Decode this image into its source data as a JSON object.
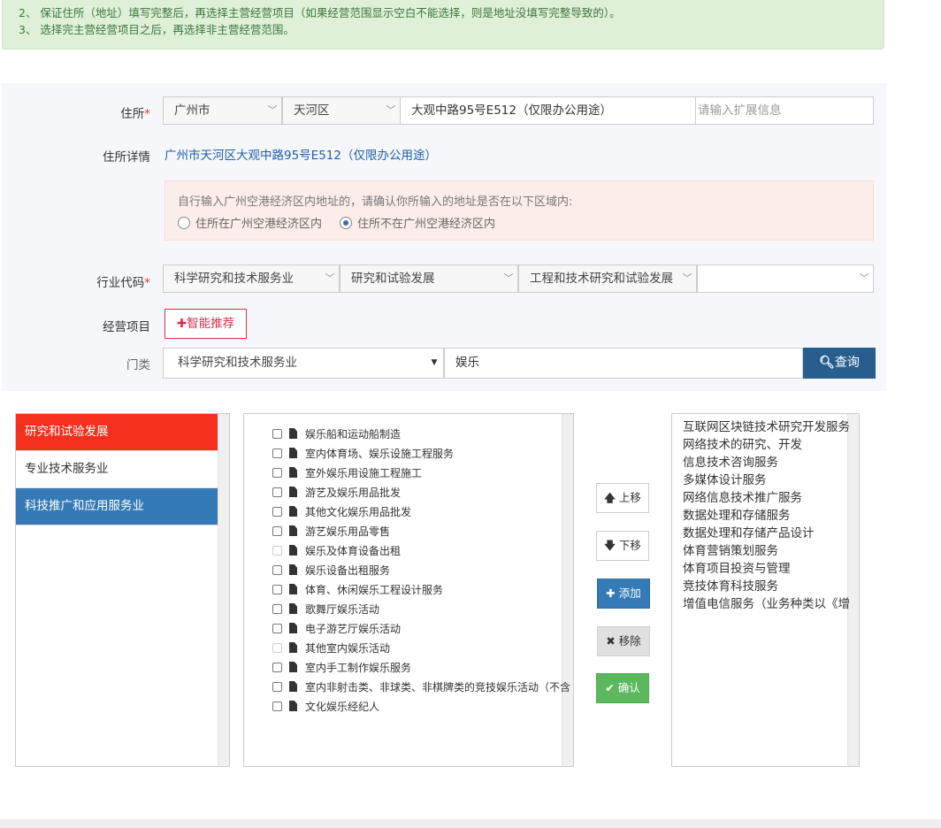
{
  "notice": {
    "line2": "2、 保证住所（地址）填写完整后，再选择主营经营项目（如果经营范围显示空白不能选择，则是地址没填写完整导致的）。",
    "line3": "3、 选择完主营经营项目之后，再选择非主营经营范围。"
  },
  "address": {
    "label": "住所",
    "required_mark": "*",
    "city": "广州市",
    "district": "天河区",
    "street_value": "大观中路95号E512（仅限办公用途）",
    "ext_placeholder": "请输入扩展信息",
    "detail_label": "住所详情",
    "detail_value": "广州市天河区大观中路95号E512（仅限办公用途）"
  },
  "airport_zone": {
    "prompt": "自行输入广州空港经济区内地址的，请确认你所输入的地址是否在以下区域内:",
    "options": [
      "住所在广州空港经济区内",
      "住所不在广州空港经济区内"
    ],
    "selected_index": 1
  },
  "industry": {
    "label": "行业代码",
    "required_mark": "*",
    "level1": "科学研究和技术服务业",
    "level2": "研究和试验发展",
    "level3": "工程和技术研究和试验发展",
    "level4": ""
  },
  "business": {
    "label": "经营项目",
    "smart_button": "智能推荐",
    "category_label": "门类",
    "category_value": "科学研究和技术服务业",
    "search_value": "娱乐",
    "query_button": "查询"
  },
  "categories": [
    "研究和试验发展",
    "专业技术服务业",
    "科技推广和应用服务业"
  ],
  "items": [
    {
      "label": "娱乐船和运动船制造",
      "disabled": false
    },
    {
      "label": "室内体育场、娱乐设施工程服务",
      "disabled": false
    },
    {
      "label": "室外娱乐用设施工程施工",
      "disabled": false
    },
    {
      "label": "游艺及娱乐用品批发",
      "disabled": false
    },
    {
      "label": "其他文化娱乐用品批发",
      "disabled": false
    },
    {
      "label": "游艺娱乐用品零售",
      "disabled": false
    },
    {
      "label": "娱乐及体育设备出租",
      "disabled": true
    },
    {
      "label": "娱乐设备出租服务",
      "disabled": false
    },
    {
      "label": "体育、休闲娱乐工程设计服务",
      "disabled": false
    },
    {
      "label": "歌舞厅娱乐活动",
      "disabled": false
    },
    {
      "label": "电子游艺厅娱乐活动",
      "disabled": false
    },
    {
      "label": "其他室内娱乐活动",
      "disabled": true
    },
    {
      "label": "室内手工制作娱乐服务",
      "disabled": false
    },
    {
      "label": "室内非射击类、非球类、非棋牌类的竞技娱乐活动（不含",
      "disabled": false
    },
    {
      "label": "文化娱乐经纪人",
      "disabled": false
    }
  ],
  "actions": {
    "up": "上移",
    "down": "下移",
    "add": "添加",
    "remove": "移除",
    "confirm": "确认"
  },
  "selected": [
    "互联网区块链技术研究开发服务",
    "网络技术的研究、开发",
    "信息技术咨询服务",
    "多媒体设计服务",
    "网络信息技术推广服务",
    "数据处理和存储服务",
    "数据处理和存储产品设计",
    "体育营销策划服务",
    "体育项目投资与管理",
    "竞技体育科技服务",
    "增值电信服务（业务种类以《增"
  ],
  "colors": {
    "notice_bg": "#dff0d8",
    "form_bg": "#f5f7fa",
    "primary": "#337ab7",
    "query": "#285e8e",
    "active_red": "#f52f1d",
    "success": "#5cb85c",
    "link": "#1e5fa8"
  }
}
